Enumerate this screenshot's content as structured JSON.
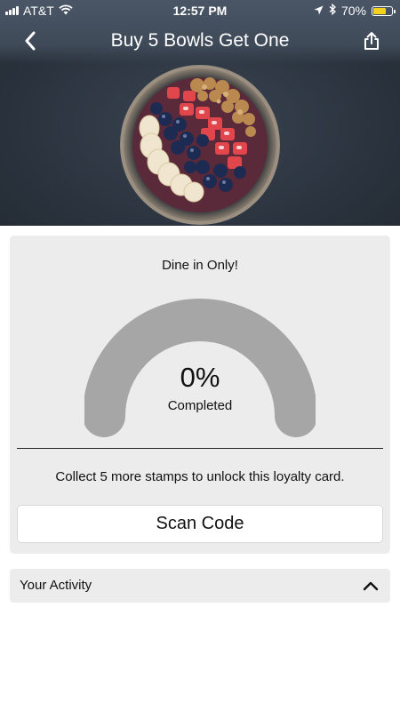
{
  "status_bar": {
    "carrier": "AT&T",
    "time": "12:57 PM",
    "battery": "70%",
    "battery_level": 0.7,
    "battery_color": "#f4d21c",
    "icons": [
      "signal-icon",
      "wifi-icon",
      "location-arrow-icon",
      "bluetooth-icon",
      "battery-icon"
    ]
  },
  "nav": {
    "title": "Buy 5 Bowls Get One",
    "back_icon": "chevron-left-icon",
    "share_icon": "share-icon"
  },
  "card": {
    "note": "Dine in Only!",
    "progress_percent": "0%",
    "progress_value": 0,
    "progress_label": "Completed",
    "message": "Collect 5 more stamps to unlock this loyalty card.",
    "scan_button": "Scan Code",
    "gauge_track_color": "#a6a6a6"
  },
  "activity": {
    "label": "Your Activity",
    "toggle_icon": "chevron-up-icon"
  }
}
